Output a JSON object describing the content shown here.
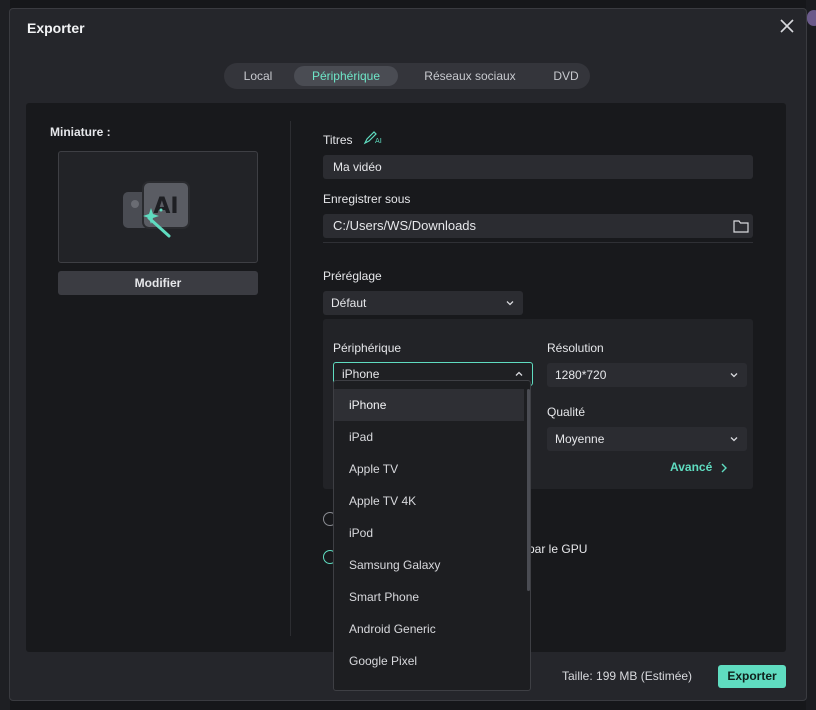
{
  "dialog": {
    "title": "Exporter"
  },
  "tabs": [
    {
      "label": "Local"
    },
    {
      "label": "Périphérique"
    },
    {
      "label": "Réseaux sociaux"
    },
    {
      "label": "DVD"
    }
  ],
  "thumbnail": {
    "label": "Miniature :",
    "modify_label": "Modifier"
  },
  "titles": {
    "label": "Titres",
    "value": "Ma vidéo"
  },
  "save_as": {
    "label": "Enregistrer sous",
    "value": "C:/Users/WS/Downloads"
  },
  "preset": {
    "label": "Préréglage",
    "value": "Défaut"
  },
  "device": {
    "label": "Périphérique",
    "value": "iPhone"
  },
  "resolution": {
    "label": "Résolution",
    "value": "1280*720"
  },
  "quality": {
    "label": "Qualité",
    "value": "Moyenne"
  },
  "advanced_label": "Avancé",
  "gpu_label": "é par le GPU",
  "size_label": "Taille: 199 MB (Estimée)",
  "export_label": "Exporter",
  "dropdown": {
    "items": [
      "iPhone",
      "iPad",
      "Apple TV",
      "Apple TV 4K",
      "iPod",
      "Samsung Galaxy",
      "Smart Phone",
      "Android Generic",
      "Google Pixel"
    ],
    "selected": "iPhone"
  },
  "colors": {
    "accent": "#5fdcc0",
    "panel": "#18191c",
    "dialog": "#25262b"
  }
}
